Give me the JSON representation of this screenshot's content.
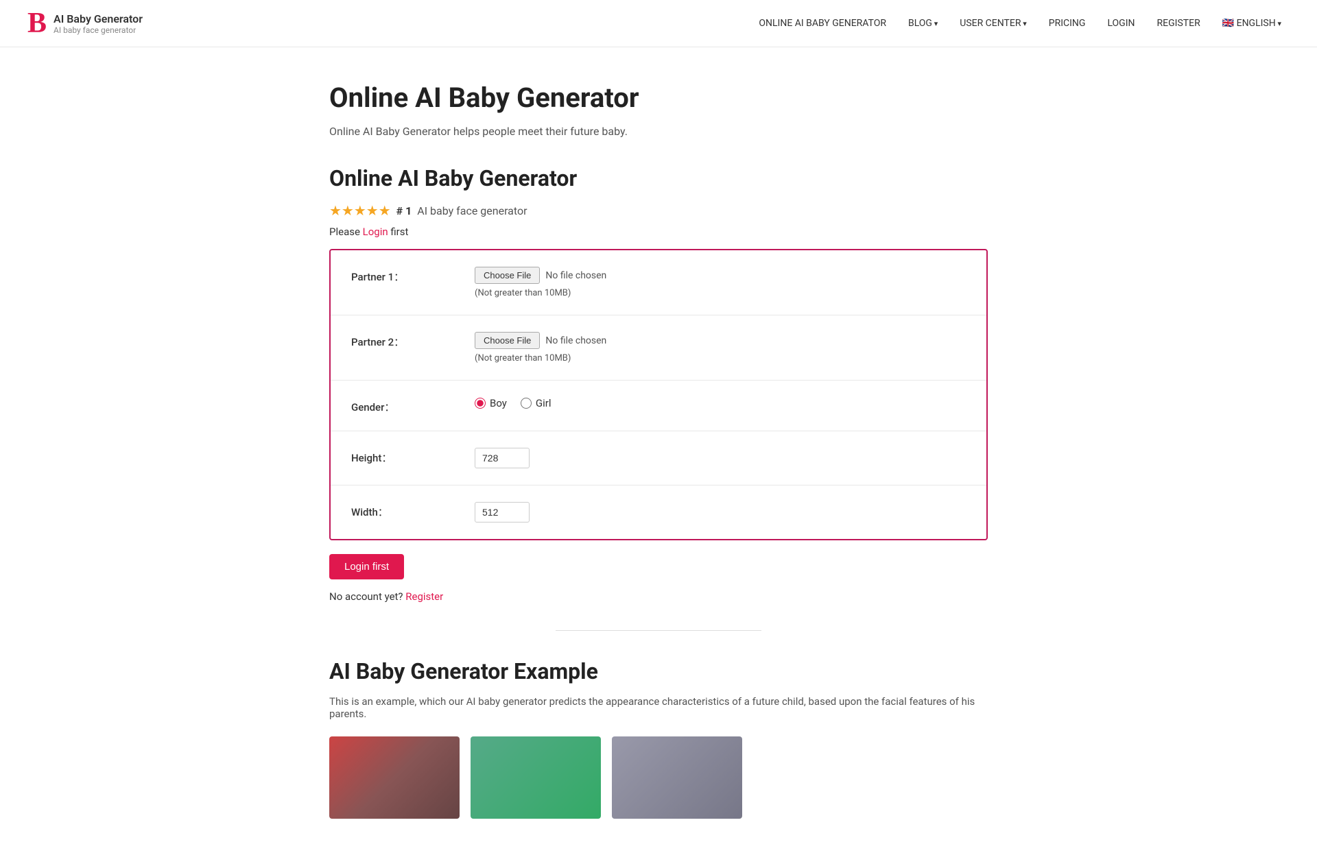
{
  "header": {
    "logo_letter": "B",
    "logo_title": "AI Baby Generator",
    "logo_subtitle": "AI baby face generator",
    "nav": [
      {
        "id": "online-generator",
        "label": "ONLINE AI BABY GENERATOR",
        "has_arrow": false
      },
      {
        "id": "blog",
        "label": "BLOG",
        "has_arrow": true
      },
      {
        "id": "user-center",
        "label": "USER CENTER",
        "has_arrow": true
      },
      {
        "id": "pricing",
        "label": "PRICING",
        "has_arrow": false
      },
      {
        "id": "login",
        "label": "LOGIN",
        "has_arrow": false
      },
      {
        "id": "register",
        "label": "REGISTER",
        "has_arrow": false
      },
      {
        "id": "english",
        "label": "🇬🇧 ENGLISH",
        "has_arrow": true
      }
    ]
  },
  "main": {
    "page_title": "Online AI Baby Generator",
    "page_subtitle": "Online AI Baby Generator helps people meet their future baby.",
    "section_title": "Online AI Baby Generator",
    "stars": "★★★★★",
    "rank": "# 1",
    "rank_desc": "AI baby face generator",
    "login_notice_pre": "Please ",
    "login_notice_link": "Login",
    "login_notice_post": " first",
    "form": {
      "partner1_label": "Partner 1：",
      "partner1_btn": "Choose File",
      "partner1_no_file": "No file chosen",
      "partner1_hint": "(Not greater than 10MB)",
      "partner2_label": "Partner 2：",
      "partner2_btn": "Choose File",
      "partner2_no_file": "No file chosen",
      "partner2_hint": "(Not greater than 10MB)",
      "gender_label": "Gender：",
      "gender_boy": "Boy",
      "gender_girl": "Girl",
      "height_label": "Height：",
      "height_value": "728",
      "width_label": "Width：",
      "width_value": "512"
    },
    "submit_btn": "Login first",
    "register_notice_pre": "No account yet? ",
    "register_notice_link": "Register",
    "example_title": "AI Baby Generator Example",
    "example_desc": "This is an example, which our AI baby generator predicts the appearance characteristics of a future child, based upon the facial features of his parents."
  }
}
